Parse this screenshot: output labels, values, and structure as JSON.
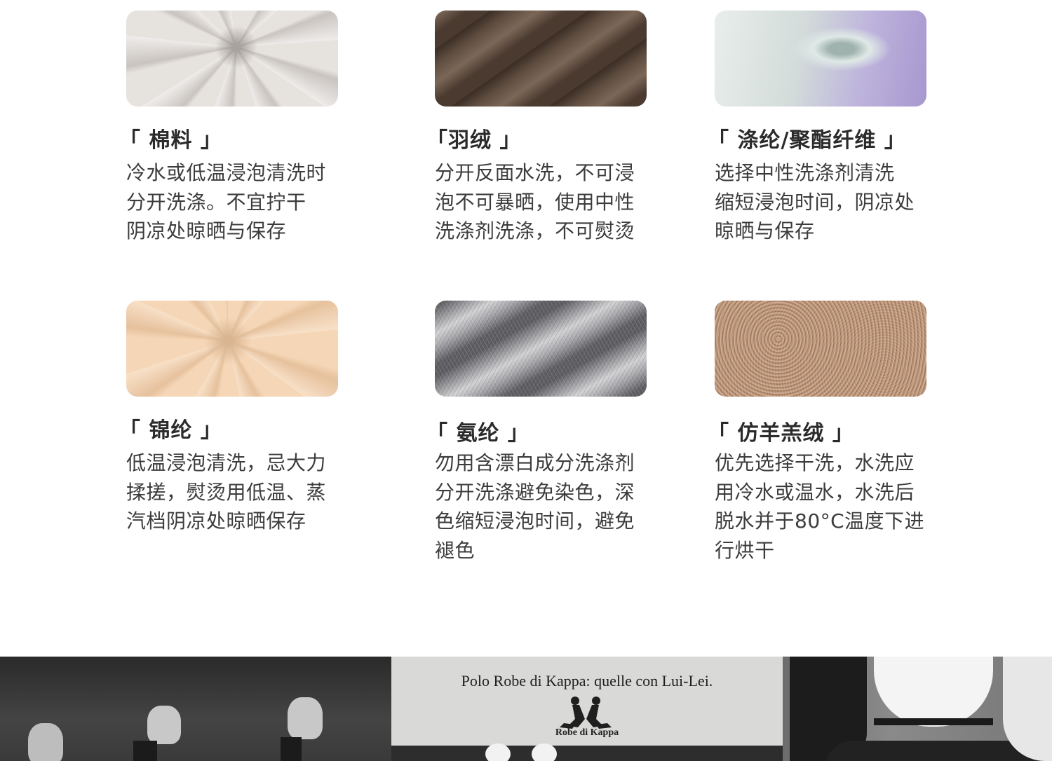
{
  "materials": [
    {
      "id": "cotton",
      "title": "「 棉料 」",
      "desc": "冷水或低温浸泡清洗时\n分开洗涤。不宜拧干\n阴凉处晾晒与保存"
    },
    {
      "id": "down",
      "title": "「羽绒 」",
      "desc": "分开反面水洗，不可浸\n泡不可暴晒，使用中性\n洗涤剂洗涤，不可熨烫"
    },
    {
      "id": "polyester",
      "title": "「 涤纶/聚酯纤维 」",
      "desc": "选择中性洗涤剂清洗\n缩短浸泡时间，阴凉处\n晾晒与保存"
    },
    {
      "id": "nylon",
      "title": "「 锦纶 」",
      "desc": "低温浸泡清洗，忌大力\n揉搓，熨烫用低温、蒸\n汽档阴凉处晾晒保存"
    },
    {
      "id": "spandex",
      "title": "「 氨纶 」",
      "desc": "勿用含漂白成分洗涤剂\n分开洗涤避免染色，深\n色缩短浸泡时间，避免\n褪色"
    },
    {
      "id": "cashmere",
      "title": "「 仿羊羔绒 」",
      "desc": "优先选择干洗，水洗应\n用冷水或温水，水洗后\n脱水并于80°C温度下进\n行烘干"
    }
  ],
  "banner": {
    "poster_text": "Polo Robe di Kappa: quelle con Lui-Lei.",
    "logo_text": "Robe di Kappa"
  }
}
